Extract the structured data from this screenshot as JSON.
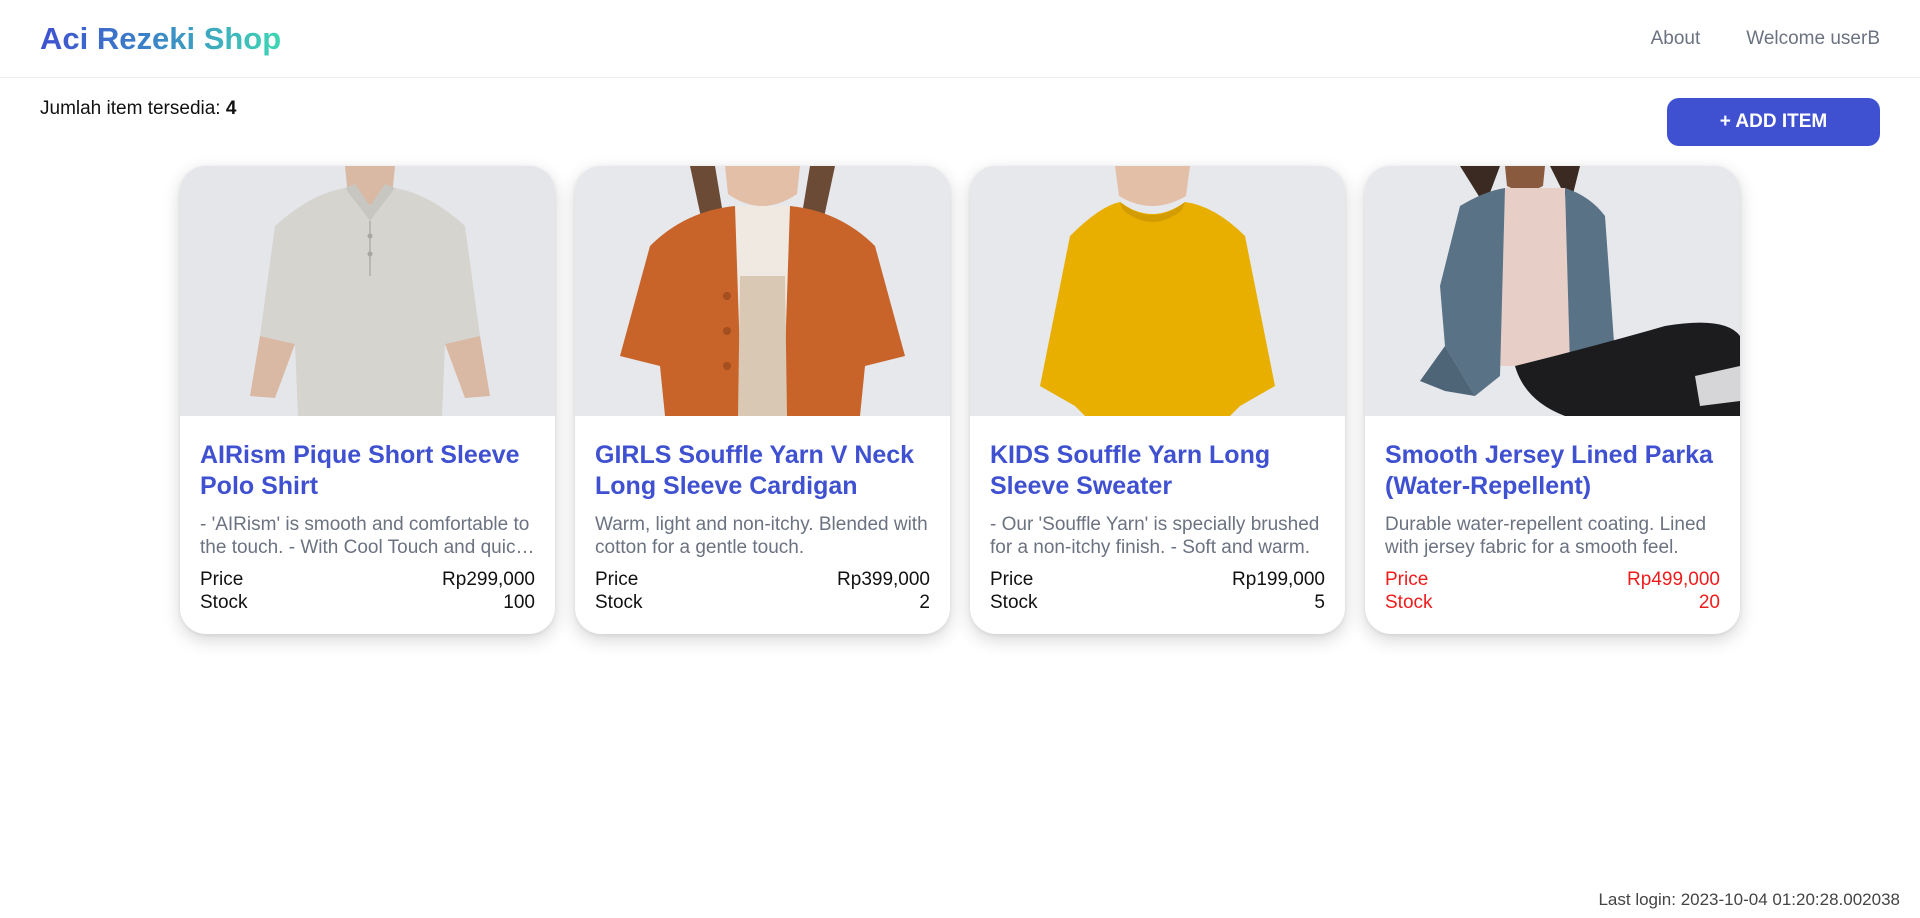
{
  "nav": {
    "brand": "Aci Rezeki Shop",
    "links": [
      "About",
      "Welcome userB"
    ]
  },
  "summary": {
    "label": "Jumlah item tersedia: ",
    "count": "4"
  },
  "add_button": "+ ADD ITEM",
  "colors": {
    "accent": "#3f51d0",
    "highlight": "#ef1c1c"
  },
  "items": [
    {
      "name": "AIRism Pique Short Sleeve Polo Shirt",
      "description": "- 'AIRism' is smooth and comfortable to the touch. - With Cool Touch and quick-drying.",
      "price_label": "Price",
      "price": "Rp299,000",
      "stock_label": "Stock",
      "stock": "100",
      "image": "polo-shirt-photo"
    },
    {
      "name": "GIRLS Souffle Yarn V Neck Long Sleeve Cardigan",
      "description": "Warm, light and non-itchy. Blended with cotton for a gentle touch.",
      "price_label": "Price",
      "price": "Rp399,000",
      "stock_label": "Stock",
      "stock": "2",
      "image": "cardigan-photo"
    },
    {
      "name": "KIDS Souffle Yarn Long Sleeve Sweater",
      "description": "- Our 'Souffle Yarn' is specially brushed for a non-itchy finish. - Soft and warm.",
      "price_label": "Price",
      "price": "Rp199,000",
      "stock_label": "Stock",
      "stock": "5",
      "image": "sweater-photo"
    },
    {
      "name": "Smooth Jersey Lined Parka (Water-Repellent)",
      "description": "Durable water-repellent coating. Lined with jersey fabric for a smooth feel.",
      "price_label": "Price",
      "price": "Rp499,000",
      "stock_label": "Stock",
      "stock": "20",
      "image": "parka-photo"
    }
  ],
  "footer": {
    "last_login": "Last login: 2023-10-04 01:20:28.002038"
  }
}
